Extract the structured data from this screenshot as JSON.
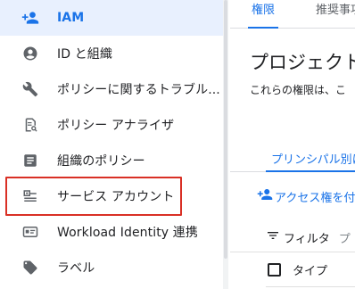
{
  "sidebar": {
    "items": [
      {
        "label": "IAM",
        "icon": "person-add-icon",
        "active": true
      },
      {
        "label": "ID と組織",
        "icon": "account-circle-icon",
        "active": false
      },
      {
        "label": "ポリシーに関するトラブル...",
        "icon": "wrench-icon",
        "active": false
      },
      {
        "label": "ポリシー アナライザ",
        "icon": "policy-analyzer-icon",
        "active": false
      },
      {
        "label": "組織のポリシー",
        "icon": "list-document-icon",
        "active": false
      },
      {
        "label": "サービス アカウント",
        "icon": "service-account-icon",
        "active": false,
        "highlighted": true
      },
      {
        "label": "Workload Identity 連携",
        "icon": "id-card-icon",
        "active": false
      },
      {
        "label": "ラベル",
        "icon": "label-tag-icon",
        "active": false
      }
    ]
  },
  "main": {
    "tabs": [
      {
        "label": "権限",
        "active": true
      },
      {
        "label": "推奨事項",
        "active": false
      }
    ],
    "title": "プロジェクト",
    "description": "これらの権限は、こ",
    "sub_tab": "プリンシパル別に",
    "add_access_label": "アクセス権を付",
    "filter_label": "フィルタ",
    "filter_placeholder": "プ",
    "table": {
      "columns": [
        "タイプ"
      ]
    }
  },
  "colors": {
    "accent": "#1a73e8",
    "active_bg": "#e8f0fe",
    "highlight_border": "#d93025",
    "icon_gray": "#5f6368"
  }
}
